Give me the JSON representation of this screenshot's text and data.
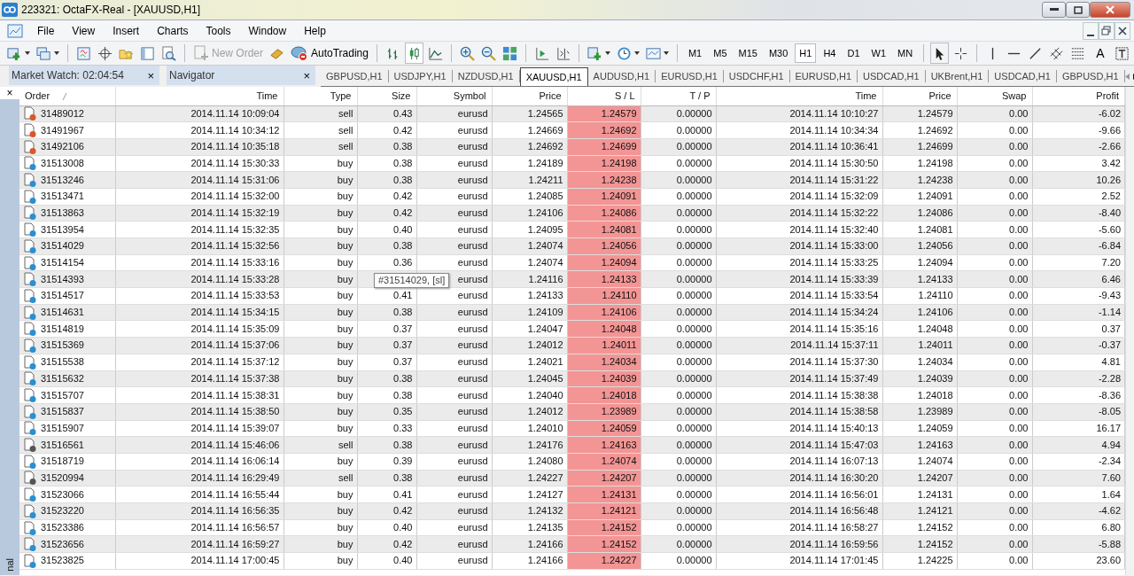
{
  "window": {
    "title": "223321: OctaFX-Real - [XAUUSD,H1]"
  },
  "menu": [
    "File",
    "View",
    "Insert",
    "Charts",
    "Tools",
    "Window",
    "Help"
  ],
  "toolbar": {
    "new_order": {
      "label": "New Order",
      "disabled": true
    },
    "autotrading": {
      "label": "AutoTrading",
      "disabled": false
    },
    "timeframes": [
      {
        "label": "M1",
        "selected": false
      },
      {
        "label": "M5",
        "selected": false
      },
      {
        "label": "M15",
        "selected": false
      },
      {
        "label": "M30",
        "selected": false
      },
      {
        "label": "H1",
        "selected": true
      },
      {
        "label": "H4",
        "selected": false
      },
      {
        "label": "D1",
        "selected": false
      },
      {
        "label": "W1",
        "selected": false
      },
      {
        "label": "MN",
        "selected": false
      }
    ],
    "text_tool": "A"
  },
  "panels": [
    {
      "title": "Market Watch: 02:04:54",
      "close": "×"
    },
    {
      "title": "Navigator",
      "close": "×"
    }
  ],
  "chart_tabs": [
    {
      "label": "GBPUSD,H1",
      "selected": false
    },
    {
      "label": "USDJPY,H1",
      "selected": false
    },
    {
      "label": "NZDUSD,H1",
      "selected": false
    },
    {
      "label": "XAUUSD,H1",
      "selected": true
    },
    {
      "label": "AUDUSD,H1",
      "selected": false
    },
    {
      "label": "EURUSD,H1",
      "selected": false
    },
    {
      "label": "USDCHF,H1",
      "selected": false
    },
    {
      "label": "EURUSD,H1",
      "selected": false
    },
    {
      "label": "USDCAD,H1",
      "selected": false
    },
    {
      "label": "UKBrent,H1",
      "selected": false
    },
    {
      "label": "USDCAD,H1",
      "selected": false
    },
    {
      "label": "GBPUSD,H1",
      "selected": false
    }
  ],
  "terminal": {
    "close": "×",
    "side_label": "nal"
  },
  "table": {
    "columns": [
      "Order",
      "Time",
      "Type",
      "Size",
      "Symbol",
      "Price",
      "S / L",
      "T / P",
      "Time",
      "Price",
      "Swap",
      "Profit"
    ],
    "rows": [
      {
        "order": "31489012",
        "open_time": "2014.11.14 10:09:04",
        "type": "sell",
        "size": "0.43",
        "symbol": "eurusd",
        "price": "1.24565",
        "sl": "1.24579",
        "tp": "0.00000",
        "close_time": "2014.11.14 10:10:27",
        "close_price": "1.24579",
        "swap": "0.00",
        "profit": "-6.02",
        "color": "#d9572b"
      },
      {
        "order": "31491967",
        "open_time": "2014.11.14 10:34:12",
        "type": "sell",
        "size": "0.42",
        "symbol": "eurusd",
        "price": "1.24669",
        "sl": "1.24692",
        "tp": "0.00000",
        "close_time": "2014.11.14 10:34:34",
        "close_price": "1.24692",
        "swap": "0.00",
        "profit": "-9.66",
        "color": "#d9572b"
      },
      {
        "order": "31492106",
        "open_time": "2014.11.14 10:35:18",
        "type": "sell",
        "size": "0.38",
        "symbol": "eurusd",
        "price": "1.24692",
        "sl": "1.24699",
        "tp": "0.00000",
        "close_time": "2014.11.14 10:36:41",
        "close_price": "1.24699",
        "swap": "0.00",
        "profit": "-2.66",
        "color": "#d9572b"
      },
      {
        "order": "31513008",
        "open_time": "2014.11.14 15:30:33",
        "type": "buy",
        "size": "0.38",
        "symbol": "eurusd",
        "price": "1.24189",
        "sl": "1.24198",
        "tp": "0.00000",
        "close_time": "2014.11.14 15:30:50",
        "close_price": "1.24198",
        "swap": "0.00",
        "profit": "3.42",
        "color": "#2b8fd0"
      },
      {
        "order": "31513246",
        "open_time": "2014.11.14 15:31:06",
        "type": "buy",
        "size": "0.38",
        "symbol": "eurusd",
        "price": "1.24211",
        "sl": "1.24238",
        "tp": "0.00000",
        "close_time": "2014.11.14 15:31:22",
        "close_price": "1.24238",
        "swap": "0.00",
        "profit": "10.26",
        "color": "#2b8fd0"
      },
      {
        "order": "31513471",
        "open_time": "2014.11.14 15:32:00",
        "type": "buy",
        "size": "0.42",
        "symbol": "eurusd",
        "price": "1.24085",
        "sl": "1.24091",
        "tp": "0.00000",
        "close_time": "2014.11.14 15:32:09",
        "close_price": "1.24091",
        "swap": "0.00",
        "profit": "2.52",
        "color": "#2b8fd0"
      },
      {
        "order": "31513863",
        "open_time": "2014.11.14 15:32:19",
        "type": "buy",
        "size": "0.42",
        "symbol": "eurusd",
        "price": "1.24106",
        "sl": "1.24086",
        "tp": "0.00000",
        "close_time": "2014.11.14 15:32:22",
        "close_price": "1.24086",
        "swap": "0.00",
        "profit": "-8.40",
        "color": "#2b8fd0"
      },
      {
        "order": "31513954",
        "open_time": "2014.11.14 15:32:35",
        "type": "buy",
        "size": "0.40",
        "symbol": "eurusd",
        "price": "1.24095",
        "sl": "1.24081",
        "tp": "0.00000",
        "close_time": "2014.11.14 15:32:40",
        "close_price": "1.24081",
        "swap": "0.00",
        "profit": "-5.60",
        "color": "#2b8fd0"
      },
      {
        "order": "31514029",
        "open_time": "2014.11.14 15:32:56",
        "type": "buy",
        "size": "0.38",
        "symbol": "eurusd",
        "price": "1.24074",
        "sl": "1.24056",
        "tp": "0.00000",
        "close_time": "2014.11.14 15:33:00",
        "close_price": "1.24056",
        "swap": "0.00",
        "profit": "-6.84",
        "color": "#2b8fd0"
      },
      {
        "order": "31514154",
        "open_time": "2014.11.14 15:33:16",
        "type": "buy",
        "size": "0.36",
        "symbol": "eurusd",
        "price": "1.24074",
        "sl": "1.24094",
        "tp": "0.00000",
        "close_time": "2014.11.14 15:33:25",
        "close_price": "1.24094",
        "swap": "0.00",
        "profit": "7.20",
        "color": "#2b8fd0"
      },
      {
        "order": "31514393",
        "open_time": "2014.11.14 15:33:28",
        "type": "buy",
        "symbol": "eurusd",
        "price": "1.24116",
        "sl": "1.24133",
        "tp": "0.00000",
        "close_time": "2014.11.14 15:33:39",
        "close_price": "1.24133",
        "swap": "0.00",
        "profit": "6.46",
        "color": "#2b8fd0",
        "tooltip": "#31514029, [sl]"
      },
      {
        "order": "31514517",
        "open_time": "2014.11.14 15:33:53",
        "type": "buy",
        "size": "0.41",
        "symbol": "eurusd",
        "price": "1.24133",
        "sl": "1.24110",
        "tp": "0.00000",
        "close_time": "2014.11.14 15:33:54",
        "close_price": "1.24110",
        "swap": "0.00",
        "profit": "-9.43",
        "color": "#2b8fd0"
      },
      {
        "order": "31514631",
        "open_time": "2014.11.14 15:34:15",
        "type": "buy",
        "size": "0.38",
        "symbol": "eurusd",
        "price": "1.24109",
        "sl": "1.24106",
        "tp": "0.00000",
        "close_time": "2014.11.14 15:34:24",
        "close_price": "1.24106",
        "swap": "0.00",
        "profit": "-1.14",
        "color": "#2b8fd0"
      },
      {
        "order": "31514819",
        "open_time": "2014.11.14 15:35:09",
        "type": "buy",
        "size": "0.37",
        "symbol": "eurusd",
        "price": "1.24047",
        "sl": "1.24048",
        "tp": "0.00000",
        "close_time": "2014.11.14 15:35:16",
        "close_price": "1.24048",
        "swap": "0.00",
        "profit": "0.37",
        "color": "#2b8fd0"
      },
      {
        "order": "31515369",
        "open_time": "2014.11.14 15:37:06",
        "type": "buy",
        "size": "0.37",
        "symbol": "eurusd",
        "price": "1.24012",
        "sl": "1.24011",
        "tp": "0.00000",
        "close_time": "2014.11.14 15:37:11",
        "close_price": "1.24011",
        "swap": "0.00",
        "profit": "-0.37",
        "color": "#2b8fd0"
      },
      {
        "order": "31515538",
        "open_time": "2014.11.14 15:37:12",
        "type": "buy",
        "size": "0.37",
        "symbol": "eurusd",
        "price": "1.24021",
        "sl": "1.24034",
        "tp": "0.00000",
        "close_time": "2014.11.14 15:37:30",
        "close_price": "1.24034",
        "swap": "0.00",
        "profit": "4.81",
        "color": "#2b8fd0"
      },
      {
        "order": "31515632",
        "open_time": "2014.11.14 15:37:38",
        "type": "buy",
        "size": "0.38",
        "symbol": "eurusd",
        "price": "1.24045",
        "sl": "1.24039",
        "tp": "0.00000",
        "close_time": "2014.11.14 15:37:49",
        "close_price": "1.24039",
        "swap": "0.00",
        "profit": "-2.28",
        "color": "#2b8fd0"
      },
      {
        "order": "31515707",
        "open_time": "2014.11.14 15:38:31",
        "type": "buy",
        "size": "0.38",
        "symbol": "eurusd",
        "price": "1.24040",
        "sl": "1.24018",
        "tp": "0.00000",
        "close_time": "2014.11.14 15:38:38",
        "close_price": "1.24018",
        "swap": "0.00",
        "profit": "-8.36",
        "color": "#2b8fd0"
      },
      {
        "order": "31515837",
        "open_time": "2014.11.14 15:38:50",
        "type": "buy",
        "size": "0.35",
        "symbol": "eurusd",
        "price": "1.24012",
        "sl": "1.23989",
        "tp": "0.00000",
        "close_time": "2014.11.14 15:38:58",
        "close_price": "1.23989",
        "swap": "0.00",
        "profit": "-8.05",
        "color": "#2b8fd0"
      },
      {
        "order": "31515907",
        "open_time": "2014.11.14 15:39:07",
        "type": "buy",
        "size": "0.33",
        "symbol": "eurusd",
        "price": "1.24010",
        "sl": "1.24059",
        "tp": "0.00000",
        "close_time": "2014.11.14 15:40:13",
        "close_price": "1.24059",
        "swap": "0.00",
        "profit": "16.17",
        "color": "#2b8fd0"
      },
      {
        "order": "31516561",
        "open_time": "2014.11.14 15:46:06",
        "type": "sell",
        "size": "0.38",
        "symbol": "eurusd",
        "price": "1.24176",
        "sl": "1.24163",
        "tp": "0.00000",
        "close_time": "2014.11.14 15:47:03",
        "close_price": "1.24163",
        "swap": "0.00",
        "profit": "4.94",
        "color": "#555555"
      },
      {
        "order": "31518719",
        "open_time": "2014.11.14 16:06:14",
        "type": "buy",
        "size": "0.39",
        "symbol": "eurusd",
        "price": "1.24080",
        "sl": "1.24074",
        "tp": "0.00000",
        "close_time": "2014.11.14 16:07:13",
        "close_price": "1.24074",
        "swap": "0.00",
        "profit": "-2.34",
        "color": "#2b8fd0"
      },
      {
        "order": "31520994",
        "open_time": "2014.11.14 16:29:49",
        "type": "sell",
        "size": "0.38",
        "symbol": "eurusd",
        "price": "1.24227",
        "sl": "1.24207",
        "tp": "0.00000",
        "close_time": "2014.11.14 16:30:20",
        "close_price": "1.24207",
        "swap": "0.00",
        "profit": "7.60",
        "color": "#555555"
      },
      {
        "order": "31523066",
        "open_time": "2014.11.14 16:55:44",
        "type": "buy",
        "size": "0.41",
        "symbol": "eurusd",
        "price": "1.24127",
        "sl": "1.24131",
        "tp": "0.00000",
        "close_time": "2014.11.14 16:56:01",
        "close_price": "1.24131",
        "swap": "0.00",
        "profit": "1.64",
        "color": "#2b8fd0"
      },
      {
        "order": "31523220",
        "open_time": "2014.11.14 16:56:35",
        "type": "buy",
        "size": "0.42",
        "symbol": "eurusd",
        "price": "1.24132",
        "sl": "1.24121",
        "tp": "0.00000",
        "close_time": "2014.11.14 16:56:48",
        "close_price": "1.24121",
        "swap": "0.00",
        "profit": "-4.62",
        "color": "#2b8fd0"
      },
      {
        "order": "31523386",
        "open_time": "2014.11.14 16:56:57",
        "type": "buy",
        "size": "0.40",
        "symbol": "eurusd",
        "price": "1.24135",
        "sl": "1.24152",
        "tp": "0.00000",
        "close_time": "2014.11.14 16:58:27",
        "close_price": "1.24152",
        "swap": "0.00",
        "profit": "6.80",
        "color": "#2b8fd0"
      },
      {
        "order": "31523656",
        "open_time": "2014.11.14 16:59:27",
        "type": "buy",
        "size": "0.42",
        "symbol": "eurusd",
        "price": "1.24166",
        "sl": "1.24152",
        "tp": "0.00000",
        "close_time": "2014.11.14 16:59:56",
        "close_price": "1.24152",
        "swap": "0.00",
        "profit": "-5.88",
        "color": "#2b8fd0"
      },
      {
        "order": "31523825",
        "open_time": "2014.11.14 17:00:45",
        "type": "buy",
        "size": "0.40",
        "symbol": "eurusd",
        "price": "1.24166",
        "sl": "1.24227",
        "tp": "0.00000",
        "close_time": "2014.11.14 17:01:45",
        "close_price": "1.24225",
        "swap": "0.00",
        "profit": "23.60",
        "color": "#2b8fd0"
      }
    ]
  }
}
